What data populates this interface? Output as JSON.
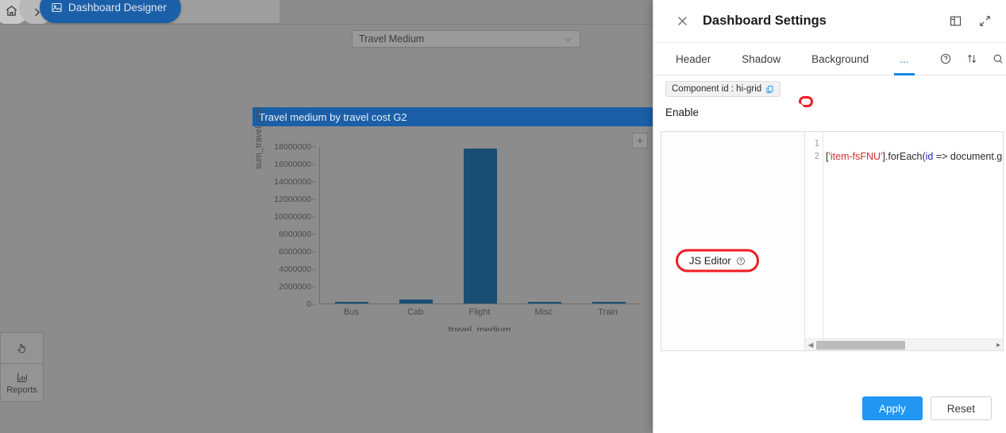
{
  "breadcrumb": {
    "home_icon": "home-icon",
    "chevron_icon": "chevron-right-icon",
    "active_icon": "dashboard-image-icon",
    "active_label": "Dashboard Designer"
  },
  "filter": {
    "label": "Travel Medium",
    "chevron": "chevron-down-icon"
  },
  "tool_rail": {
    "items": [
      {
        "icon": "hand-pointer-icon",
        "label": ""
      },
      {
        "icon": "bar-chart-icon",
        "label": "Reports"
      }
    ]
  },
  "chart_data": {
    "type": "bar",
    "title": "Travel medium by travel cost G2",
    "categories": [
      "Bus",
      "Cab",
      "Flight",
      "Misc",
      "Train"
    ],
    "values": [
      130000,
      430000,
      17700000,
      170000,
      140000
    ],
    "xlabel": "travel_medium",
    "ylabel": "sum_travel_cost",
    "ylim": [
      0,
      18000000
    ],
    "yticks": [
      0,
      2000000,
      4000000,
      6000000,
      8000000,
      10000000,
      12000000,
      14000000,
      16000000,
      18000000
    ],
    "ytick_labels": [
      "0",
      "2000000",
      "4000000",
      "6000000",
      "8000000",
      "10000000",
      "12000000",
      "14000000",
      "16000000",
      "18000000"
    ],
    "grid": false,
    "legend": null,
    "bar_color": "#1a4e72",
    "title_bar_color": "#1b5fa8",
    "expand_button_icon": "expand-icon"
  },
  "settings_panel": {
    "close_icon": "close-icon",
    "title": "Dashboard Settings",
    "header_actions": [
      {
        "icon": "layout-panel-icon"
      },
      {
        "icon": "expand-diagonal-icon"
      }
    ],
    "tabs": [
      {
        "label": "Header",
        "active": false
      },
      {
        "label": "Shadow",
        "active": false
      },
      {
        "label": "Background",
        "active": false
      },
      {
        "label": "...",
        "active": true
      }
    ],
    "tab_icons": [
      {
        "icon": "help-circle-icon"
      },
      {
        "icon": "sort-updown-icon"
      },
      {
        "icon": "search-icon"
      }
    ],
    "component_id": {
      "label": "Component id : hi-grid",
      "copy_icon": "copy-icon"
    },
    "enable": {
      "label": "Enable",
      "value": true,
      "highlight_color": "#ee1c25",
      "toggle_on_color": "#2196f3"
    },
    "js_editor": {
      "label": "JS Editor",
      "help_icon": "help-circle-icon",
      "highlight_color": "#ee1c25",
      "line_numbers": [
        "1",
        "2"
      ],
      "lines": [
        {
          "number": "1",
          "text": ""
        },
        {
          "number": "2",
          "prefix": "[",
          "string": "'item-fsFNU'",
          "mid": "].forEach(",
          "variable": "id",
          "suffix": " => document.g"
        }
      ],
      "scrollbar": {
        "left_arrow": "left-arrow-icon",
        "right_arrow": "right-arrow-icon"
      }
    },
    "footer": {
      "apply_label": "Apply",
      "reset_label": "Reset"
    }
  }
}
